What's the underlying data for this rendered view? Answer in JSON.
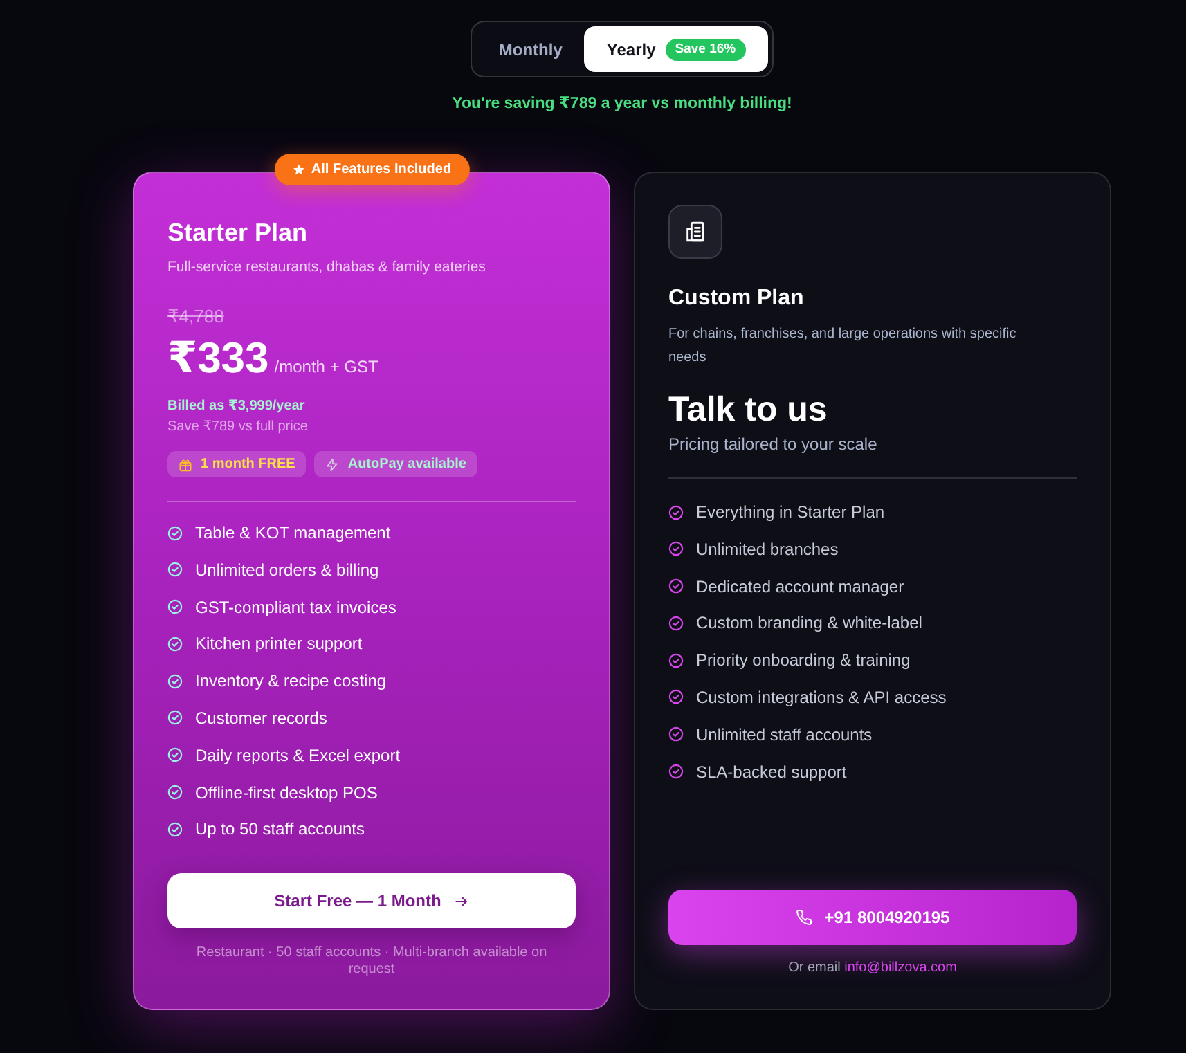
{
  "billing_toggle": {
    "options": [
      {
        "label": "Monthly",
        "selected": false
      },
      {
        "label": "Yearly",
        "selected": true,
        "badge": "Save 16%"
      }
    ]
  },
  "savings_note": "You're saving ₹789 a year vs monthly billing!",
  "plans": [
    {
      "kind": "featured",
      "ribbon": "All Features Included",
      "name": "Starter Plan",
      "description": "Full-service restaurants, dhabas & family eateries",
      "original_price": "₹4,788",
      "price": "₹333",
      "price_suffix": "/month + GST",
      "billed_note": "Billed as ₹3,999/year",
      "save_note": "Save ₹789 vs full price",
      "perks": [
        {
          "kind": "gift",
          "label": "1 month FREE"
        },
        {
          "kind": "bolt",
          "label": "AutoPay available"
        }
      ],
      "features": [
        "Table & KOT management",
        "Unlimited orders & billing",
        "GST-compliant tax invoices",
        "Kitchen printer support",
        "Inventory & recipe costing",
        "Customer records",
        "Daily reports & Excel export",
        "Offline-first desktop POS",
        "Up to 50 staff accounts"
      ],
      "cta": "Start Free — 1 Month",
      "footnote": "Restaurant · 50 staff accounts · Multi-branch available on request"
    },
    {
      "kind": "custom",
      "name": "Custom Plan",
      "description": "For chains, franchises, and large operations with specific needs",
      "headline": "Talk to us",
      "subheadline": "Pricing tailored to your scale",
      "features": [
        "Everything in Starter Plan",
        "Unlimited branches",
        "Dedicated account manager",
        "Custom branding & white-label",
        "Priority onboarding & training",
        "Custom integrations & API access",
        "Unlimited staff accounts",
        "SLA-backed support"
      ],
      "cta": "+91 8004920195",
      "contact_note": "Or email",
      "contact_email": "info@billzova.com"
    }
  ]
}
